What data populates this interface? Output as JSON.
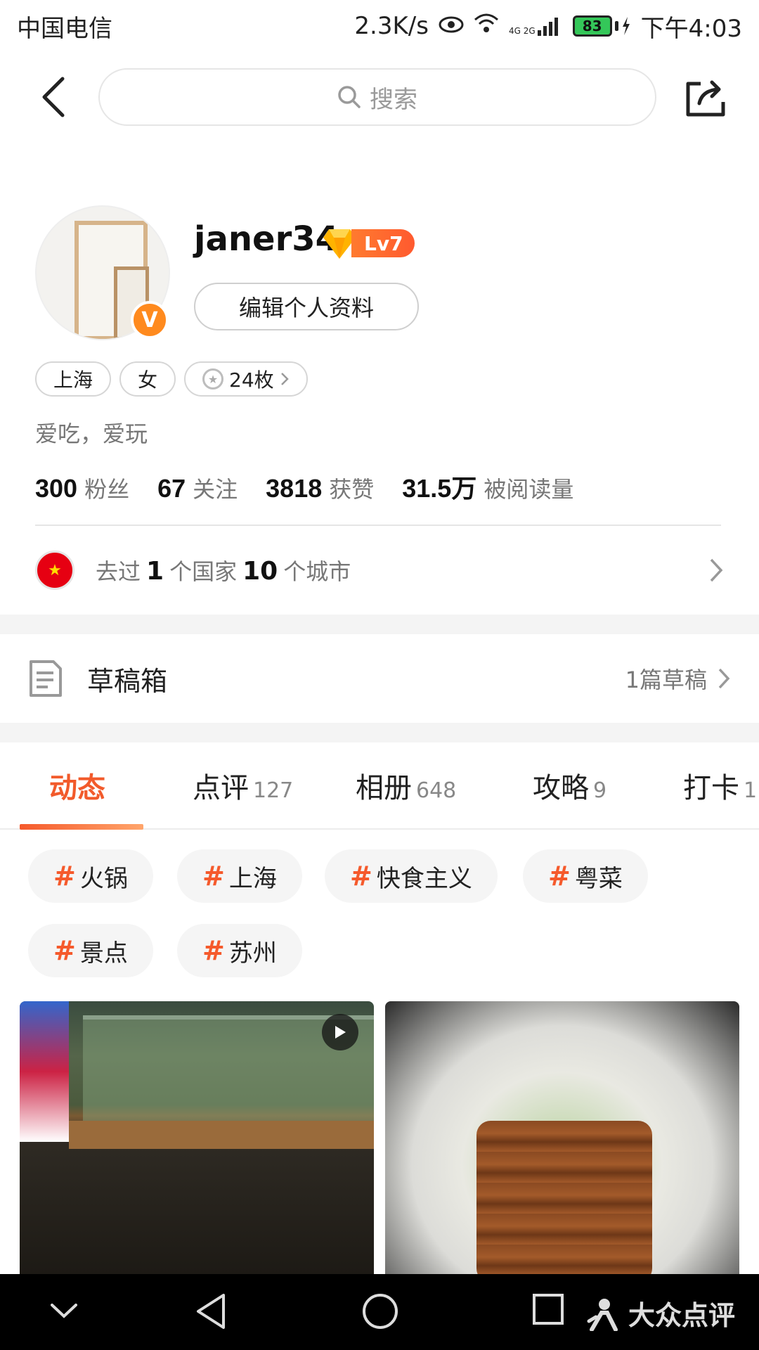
{
  "status_bar": {
    "carrier": "中国电信",
    "net_speed": "2.3K/s",
    "network": "4G 2G",
    "battery": "83",
    "time": "下午4:03"
  },
  "top_nav": {
    "search_placeholder": "搜索"
  },
  "profile": {
    "username": "janer34",
    "level": "Lv7",
    "edit_label": "编辑个人资料",
    "tags": [
      "上海",
      "女",
      "24枚"
    ],
    "bio": "爱吃，爱玩",
    "stats": [
      {
        "num": "300",
        "label": "粉丝"
      },
      {
        "num": "67",
        "label": "关注"
      },
      {
        "num": "3818",
        "label": "获赞"
      },
      {
        "num": "31.5万",
        "label": "被阅读量"
      }
    ],
    "travel": {
      "prefix": "去过",
      "countries": "1",
      "countries_label": "个国家",
      "cities": "10",
      "cities_label": "个城市"
    }
  },
  "drafts": {
    "title": "草稿箱",
    "count": "1篇草稿"
  },
  "tabs": [
    {
      "label": "动态",
      "count": ""
    },
    {
      "label": "点评",
      "count": "127"
    },
    {
      "label": "相册",
      "count": "648"
    },
    {
      "label": "攻略",
      "count": "9"
    },
    {
      "label": "打卡",
      "count": "1"
    }
  ],
  "hashtags": [
    "火锅",
    "上海",
    "快食主义",
    "粤菜",
    "景点",
    "苏州"
  ],
  "brand": "大众点评",
  "colors": {
    "accent": "#f25a2b",
    "level_badge": "#ff6a2f",
    "verified_badge": "#ff8a1e"
  }
}
